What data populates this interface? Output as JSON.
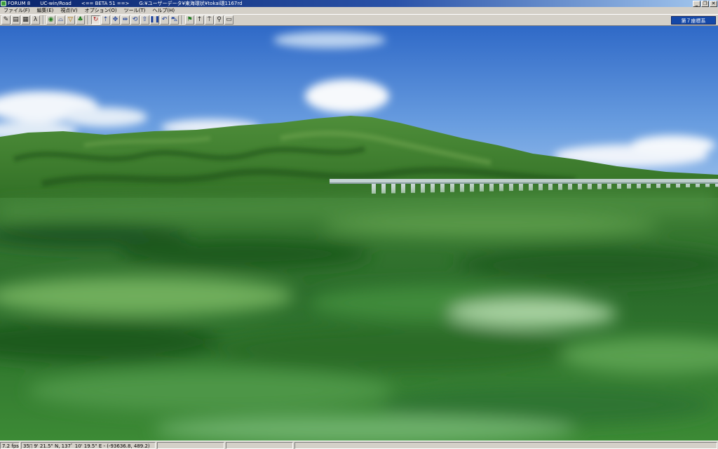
{
  "window": {
    "app_title": "FORUM 8",
    "subtitle": "UC-win/Road",
    "beta": "<== BETA 51 ==>",
    "file_path": "G:¥ユーザーデータ¥東海環状¥tokai環1167rd",
    "controls": [
      "_",
      "❐",
      "✕"
    ]
  },
  "menu": [
    "ファイル(F)",
    "編集(E)",
    "視点(V)",
    "オプション(O)",
    "ツール(T)",
    "ヘルプ(H)"
  ],
  "toolbar": {
    "coord_system_label": "第７座標系"
  },
  "status": {
    "fps": "7.2 fps",
    "position": "35ﾟ 9' 21.5\" N, 137ﾟ 10' 19.5\" E   -  (-93636.8, 489.2)",
    "field2": "",
    "field3": "",
    "field4": ""
  },
  "colors": {
    "sky_top": "#2f69c7",
    "sky_horizon": "#9fc2ea",
    "mountain": "#3c7d2c",
    "ground": "#2f7a2a",
    "viaduct": "#c8d4d8"
  }
}
